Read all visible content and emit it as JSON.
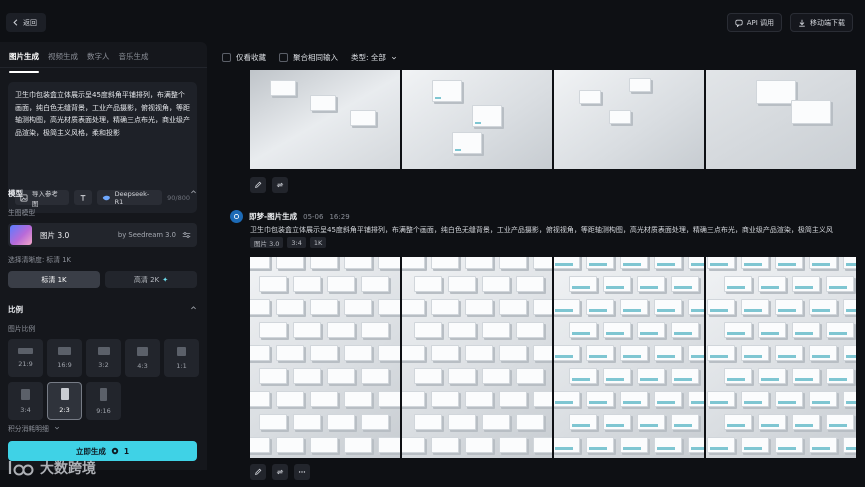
{
  "topbar": {
    "back_label": "返回",
    "api_label": "API 调用",
    "download_label": "移动端下载"
  },
  "left": {
    "tabs": [
      {
        "label": "图片生成",
        "active": true
      },
      {
        "label": "视频生成",
        "active": false
      },
      {
        "label": "数字人",
        "active": false
      },
      {
        "label": "音乐生成",
        "active": false
      }
    ],
    "prompt": "卫生巾包装盒立体展示呈45度斜角平铺排列，布满整个画面，纯白色无缝背景，工业产品摄影，俯视视角，等距轴测构图，高光材质表面处理，精确三点布光，商业级产品渲染，极简主义风格，柔和投影",
    "ref_label": "导入参考图",
    "deepseek_label": "Deepseek-R1",
    "counter": "90/800",
    "model_section": "模型",
    "model_sub": "生图模型",
    "model_name": "图片 3.0",
    "model_by": "by Seedream 3.0",
    "res_label": "选择清晰度: 标清 1K",
    "res_options": [
      {
        "label": "标清 1K",
        "selected": true
      },
      {
        "label": "高清 2K",
        "selected": false
      }
    ],
    "ratio_section": "比例",
    "ratio_sub": "图片比例",
    "ratios": [
      {
        "label": "21:9",
        "selected": false
      },
      {
        "label": "16:9",
        "selected": false
      },
      {
        "label": "3:2",
        "selected": false
      },
      {
        "label": "4:3",
        "selected": false
      },
      {
        "label": "1:1",
        "selected": false
      },
      {
        "label": "3:4",
        "selected": false
      },
      {
        "label": "2:3",
        "selected": true
      },
      {
        "label": "9:16",
        "selected": false
      }
    ],
    "credit_label": "积分消耗明细",
    "generate_label": "立即生成",
    "generate_cost": "1"
  },
  "watermark": "大数跨境",
  "right": {
    "filter_fav": "仅看收藏",
    "filter_merge": "聚合相同输入",
    "filter_type": "类型: 全部",
    "entry": {
      "title": "即梦-图片生成",
      "date": "05-06",
      "time": "16:29",
      "prompt": "卫生巾包装盒立体展示呈45度斜角平铺排列，布满整个画面，纯白色无缝背景，工业产品摄影，俯视视角，等距轴测构图，高光材质表面处理，精确三点布光，商业级产品渲染，极简主义风",
      "tags": [
        "图片 3.0",
        "3:4",
        "1K"
      ]
    }
  },
  "colors": {
    "accent": "#3fd2e6",
    "background": "#0e1014",
    "panel": "#15171c"
  }
}
